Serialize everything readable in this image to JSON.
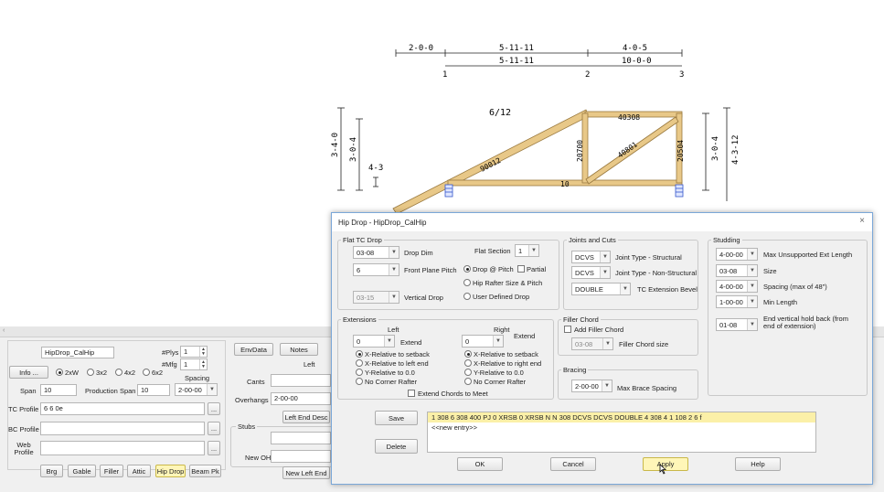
{
  "drawing": {
    "top_dims": [
      "2-0-0",
      "5-11-11",
      "4-0-5"
    ],
    "sub_dims": [
      "5-11-11",
      "10-0-0"
    ],
    "joint_numbers": [
      "1",
      "2",
      "3"
    ],
    "pitch": "6/12",
    "left_heights": [
      "3-4-0",
      "3-0-4",
      "4-3"
    ],
    "right_heights": [
      "3-0-4",
      "4-3-12"
    ],
    "member_labels": [
      "40308",
      "90012",
      "20700",
      "40801",
      "20504",
      "10"
    ]
  },
  "bottom": {
    "name": "HipDrop_CalHip",
    "plys_label": "#Plys",
    "plys": "1",
    "mfg_label": "#Mfg",
    "mfg": "1",
    "info_label": "Info ...",
    "sizes": [
      "2xW",
      "3x2",
      "4x2",
      "6x2"
    ],
    "spacing_label": "Spacing",
    "spacing": "2-00-00",
    "span_label": "Span",
    "span": "10",
    "prod_span_label": "Production Span",
    "prod_span": "10",
    "tc_profile_label": "TC Profile",
    "tc_profile": "6 6 0e",
    "bc_profile_label": "BC Profile",
    "web_profile_label": "Web Profile",
    "ellipsis": "...",
    "buttons": [
      "Brg",
      "Gable",
      "Filler",
      "Attic",
      "Hip Drop",
      "Beam Pk"
    ],
    "envdata": "EnvData",
    "notes": "Notes",
    "left_tab": "Left",
    "cants_label": "Cants",
    "overhangs_label": "Overhangs",
    "overhangs": "2-00-00",
    "left_end_desc": "Left End Desc",
    "stubs_label": "Stubs",
    "new_oh_label": "New OH",
    "new_left_end": "New Left End"
  },
  "dialog": {
    "title": "Hip Drop - HipDrop_CalHip",
    "close": "×",
    "flat_tc": {
      "group": "Flat TC Drop",
      "drop_dim": "03-08",
      "drop_dim_label": "Drop Dim",
      "flat_section_label": "Flat Section",
      "flat_section": "1",
      "front_plane": "6",
      "front_plane_label": "Front Plane Pitch",
      "drop_at_pitch": "Drop @ Pitch",
      "partial": "Partial",
      "hip_rafter": "Hip Rafter Size  & Pitch",
      "vertical_drop": "03-15",
      "vertical_drop_label": "Vertical Drop",
      "user_defined": "User Defined Drop"
    },
    "joints": {
      "group": "Joints and Cuts",
      "structural": "DCVS",
      "structural_label": "Joint Type - Structural",
      "non_structural": "DCVS",
      "non_structural_label": "Joint Type - Non-Structural",
      "bevel": "DOUBLE",
      "bevel_label": "TC Extension Bevel"
    },
    "studding": {
      "group": "Studding",
      "max_unsupported": "4-00-00",
      "max_unsupported_label": "Max Unsupported Ext Length",
      "size": "03-08",
      "size_label": "Size",
      "spacing": "4-00-00",
      "spacing_label": "Spacing (max of 48\")",
      "min_length": "1-00-00",
      "min_length_label": "Min Length",
      "hold_back": "01-08",
      "hold_back_label": "End vertical hold back (from end of extension)"
    },
    "extensions": {
      "group": "Extensions",
      "left_label": "Left",
      "right_label": "Right",
      "left_value": "0",
      "right_value": "0",
      "extend": "Extend",
      "left_options": [
        "X-Relative to setback",
        "X-Relative to left end",
        "Y-Relative to 0.0",
        "No Corner Rafter"
      ],
      "right_options": [
        "X-Relative to setback",
        "X-Relative to right end",
        "Y-Relative to 0.0",
        "No Corner Rafter"
      ],
      "extend_chords": "Extend Chords to Meet"
    },
    "filler": {
      "group": "Filler Chord",
      "add": "Add Filler Chord",
      "size": "03-08",
      "size_label": "Filler Chord size"
    },
    "bracing": {
      "group": "Bracing",
      "value": "2-00-00",
      "label": "Max Brace Spacing"
    },
    "save": "Save",
    "delete": "Delete",
    "entries": [
      "1 308 6 308 400 PJ 0 XRSB 0 XRSB N N 308 DCVS DCVS DOUBLE 4 308 4 1 108 2 6 f",
      "<<new entry>>"
    ],
    "ok": "OK",
    "cancel": "Cancel",
    "apply": "Apply",
    "help": "Help"
  },
  "colors": {
    "lumber": "#e8c888",
    "lumber_edge": "#9a7a40",
    "dialog_border": "#7aa7d8",
    "selected_row": "#fbf0a8",
    "highlight_button": "#fff6b8"
  }
}
